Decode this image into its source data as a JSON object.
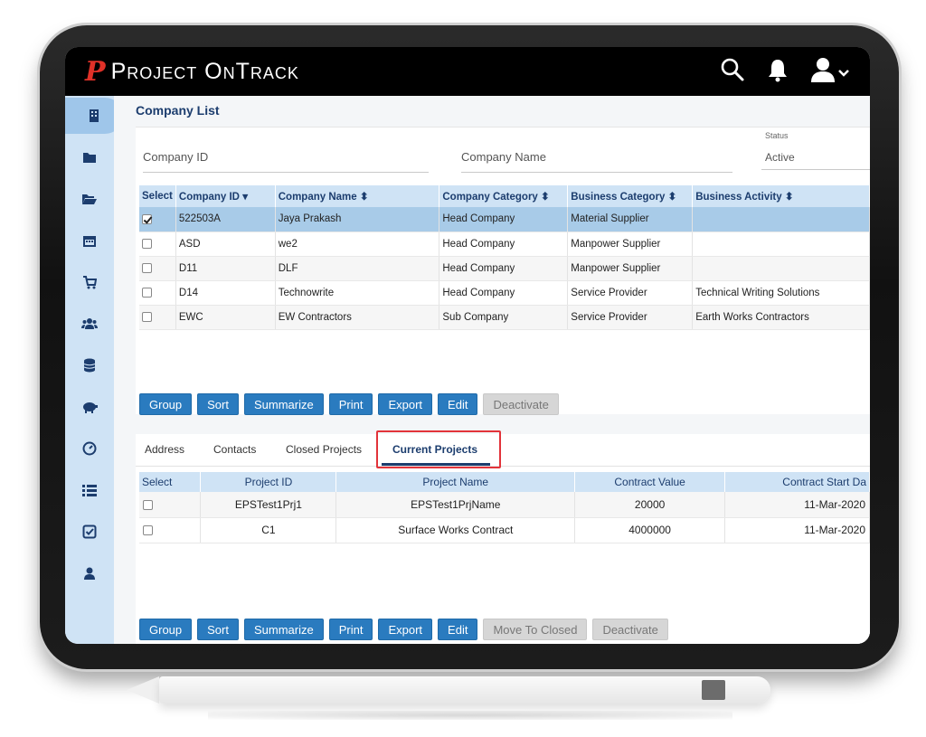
{
  "app": {
    "logo_mark": "P",
    "logo_text": "Project OnTrack"
  },
  "topbar": {
    "search_icon": "search-icon",
    "bell_icon": "bell-icon",
    "user_icon": "user-menu-icon"
  },
  "sidebar": {
    "items": [
      "building-icon",
      "folder-icon",
      "folder-open-icon",
      "calendar-icon",
      "cart-icon",
      "users-icon",
      "database-icon",
      "piggy-bank-icon",
      "gauge-icon",
      "list-icon",
      "check-square-icon",
      "user-icon"
    ]
  },
  "page": {
    "title": "Company List"
  },
  "filters": {
    "company_id_placeholder": "Company ID",
    "company_name_placeholder": "Company Name",
    "status_label": "Status",
    "status_value": "Active"
  },
  "company_table": {
    "headers": [
      "Select",
      "Company ID",
      "Company Name",
      "Company Category",
      "Business Category",
      "Business Activity"
    ],
    "rows": [
      {
        "checked": true,
        "id": "522503A",
        "name": "Jaya Prakash",
        "category": "Head Company",
        "business_category": "Material Supplier",
        "activity": ""
      },
      {
        "checked": false,
        "id": "ASD",
        "name": "we2",
        "category": "Head Company",
        "business_category": "Manpower Supplier",
        "activity": ""
      },
      {
        "checked": false,
        "id": "D11",
        "name": "DLF",
        "category": "Head Company",
        "business_category": "Manpower Supplier",
        "activity": ""
      },
      {
        "checked": false,
        "id": "D14",
        "name": "Technowrite",
        "category": "Head Company",
        "business_category": "Service Provider",
        "activity": "Technical Writing Solutions"
      },
      {
        "checked": false,
        "id": "EWC",
        "name": "EW Contractors",
        "category": "Sub Company",
        "business_category": "Service Provider",
        "activity": "Earth Works Contractors"
      }
    ]
  },
  "company_actions": {
    "group": "Group",
    "sort": "Sort",
    "summarize": "Summarize",
    "print": "Print",
    "export": "Export",
    "edit": "Edit",
    "deactivate": "Deactivate"
  },
  "tabs": {
    "address": "Address",
    "contacts": "Contacts",
    "closed": "Closed Projects",
    "current": "Current Projects"
  },
  "project_table": {
    "headers": [
      "Select",
      "Project ID",
      "Project Name",
      "Contract Value",
      "Contract Start Da"
    ],
    "rows": [
      {
        "checked": false,
        "id": "EPSTest1Prj1",
        "name": "EPSTest1PrjName",
        "value": "20000",
        "start": "11-Mar-2020"
      },
      {
        "checked": false,
        "id": "C1",
        "name": "Surface Works Contract",
        "value": "4000000",
        "start": "11-Mar-2020"
      }
    ]
  },
  "project_actions": {
    "group": "Group",
    "sort": "Sort",
    "summarize": "Summarize",
    "print": "Print",
    "export": "Export",
    "edit": "Edit",
    "move": "Move To Closed",
    "deactivate": "Deactivate"
  }
}
